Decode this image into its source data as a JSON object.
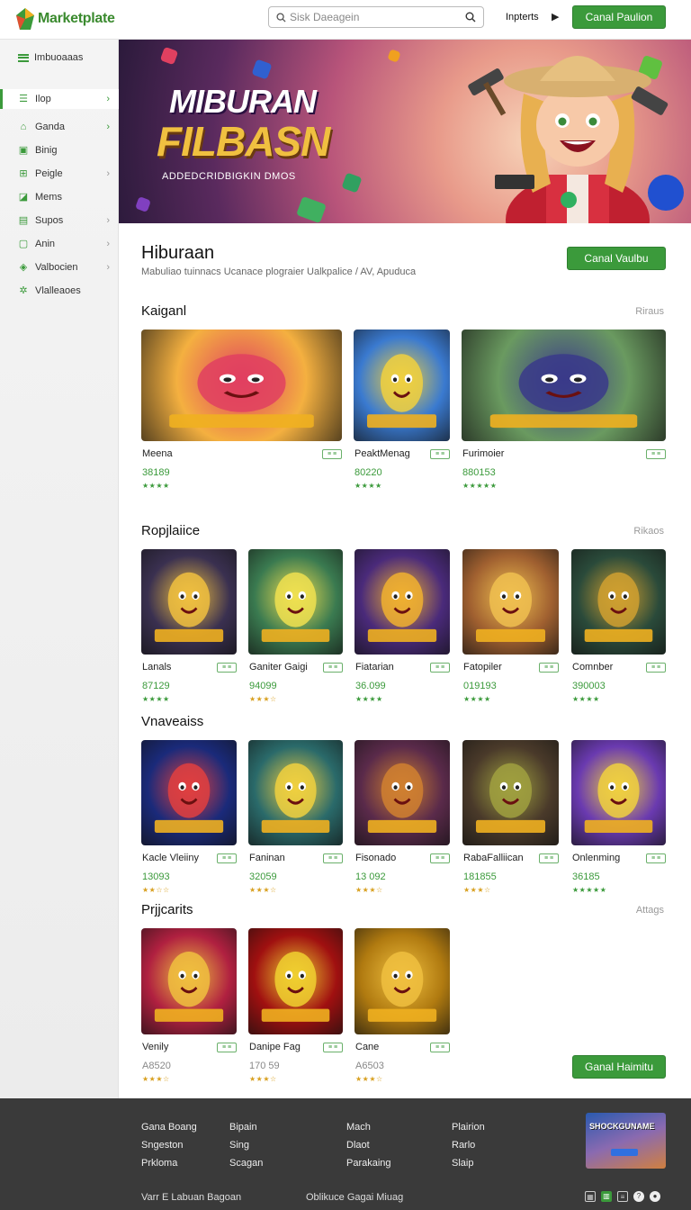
{
  "header": {
    "logo_text": "Marketplate",
    "search_placeholder": "Sisk Daeagein",
    "link": "Inpterts",
    "cta": "Canal Paulion"
  },
  "sidebar": {
    "heading": "Imbuoaaas",
    "items": [
      {
        "label": "Ilop",
        "icon": "menu-icon",
        "chevron": true,
        "active": true
      },
      {
        "label": "Ganda",
        "icon": "tag-icon",
        "chevron": true
      },
      {
        "label": "Binig",
        "icon": "user-card-icon",
        "chevron": false
      },
      {
        "label": "Peigle",
        "icon": "gamepad-icon",
        "chevron": true
      },
      {
        "label": "Mems",
        "icon": "chat-icon",
        "chevron": false
      },
      {
        "label": "Supos",
        "icon": "document-icon",
        "chevron": true
      },
      {
        "label": "Anin",
        "icon": "square-icon",
        "chevron": true
      },
      {
        "label": "Valbocien",
        "icon": "shield-icon",
        "chevron": true
      },
      {
        "label": "Vlalleaoes",
        "icon": "puzzle-icon",
        "chevron": false
      }
    ]
  },
  "hero": {
    "title_line1": "MIBURAN",
    "title_line2": "FILBASN",
    "subtitle": "ADDEDCRIDBIGKIN DMOS"
  },
  "main": {
    "title": "Hiburaan",
    "description": "Mabuliao tuinnacs Ucanace plograier Ualkpalice / AV, Apuduca",
    "cta": "Canal Vaulbu"
  },
  "sections": [
    {
      "title": "Kaiganl",
      "link": "Riraus",
      "cards": [
        {
          "name": "Meena",
          "price": "38189",
          "stars": "★★★★",
          "badge": "≡ ≡"
        },
        {
          "name": "PeaktMenag",
          "price": "80220",
          "stars": "★★★★",
          "badge": "≡ ≡"
        },
        {
          "name": "Furimoier",
          "price": "880153",
          "stars": "★★★★★",
          "badge": "≡ ≡"
        }
      ]
    },
    {
      "title": "Ropjlaiice",
      "link": "Rikaos",
      "cards": [
        {
          "name": "Lanals",
          "price": "87129",
          "stars": "★★★★",
          "badge": "≡ ≡"
        },
        {
          "name": "Ganiter Gaigi",
          "price": "94099",
          "stars": "★★★☆",
          "badge": "≡ ≡"
        },
        {
          "name": "Fiatarian",
          "price": "36.099",
          "stars": "★★★★",
          "badge": "≡ ≡"
        },
        {
          "name": "Fatopiler",
          "price": "019193",
          "stars": "★★★★",
          "badge": "≡ ≡"
        },
        {
          "name": "Comnber",
          "price": "390003",
          "stars": "★★★★",
          "badge": "≡ ≡"
        }
      ]
    },
    {
      "title": "Vnaveaiss",
      "link": "",
      "cards": [
        {
          "name": "Kacle Vleiiny",
          "price": "13093",
          "stars": "★★☆☆",
          "badge": "≡ ≡"
        },
        {
          "name": "Faninan",
          "price": "32059",
          "stars": "★★★☆",
          "badge": "≡ ≡"
        },
        {
          "name": "Fisonado",
          "price": "13 092",
          "stars": "★★★☆",
          "badge": "≡ ≡"
        },
        {
          "name": "RabaFalliican",
          "price": "181855",
          "stars": "★★★☆",
          "badge": "≡ ≡"
        },
        {
          "name": "Onlenming",
          "price": "36185",
          "stars": "★★★★★",
          "badge": "≡ ≡"
        }
      ]
    },
    {
      "title": "Prjjcarits",
      "link": "Attags",
      "cards": [
        {
          "name": "Venily",
          "price": "A8520",
          "stars": "★★★☆",
          "badge": "≡ ≡"
        },
        {
          "name": "Danipe Fag",
          "price": "170 59",
          "stars": "★★★☆",
          "badge": "≡ ≡"
        },
        {
          "name": "Cane",
          "price": "A6503",
          "stars": "★★★☆",
          "badge": "≡ ≡"
        }
      ],
      "cta": "Ganal Haimitu"
    }
  ],
  "footer": {
    "col1": [
      "Gana Boang",
      "Sngeston",
      "Prkloma"
    ],
    "col2": [
      "Bipain",
      "Sing",
      "Scagan"
    ],
    "col3": [
      "Mach",
      "Dlaot",
      "Parakaing"
    ],
    "col4": [
      "Plairion",
      "Rarlo",
      "Slaip"
    ],
    "bottom_left": "Varr E Labuan Bagoan",
    "bottom_mid": "Oblikuce Gagai Miuag",
    "thumb_title": "SHOCKGUNAME"
  },
  "colors": {
    "accent": "#3b9a3b",
    "footer": "#3a3a3a",
    "sidebar": "#f0f0f0"
  }
}
